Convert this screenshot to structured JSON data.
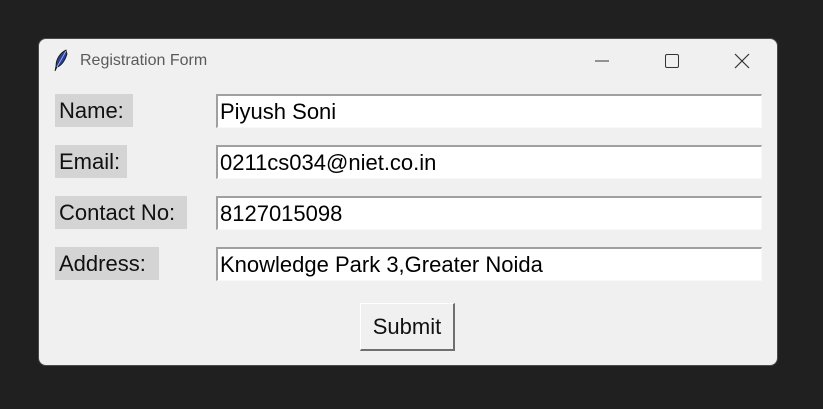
{
  "window": {
    "title": "Registration Form"
  },
  "form": {
    "name_label": "Name:",
    "name_value": "Piyush Soni",
    "email_label": "Email:",
    "email_value": "0211cs034@niet.co.in",
    "contact_label": "Contact No:",
    "contact_value": "8127015098",
    "address_label": "Address:",
    "address_value": "Knowledge Park 3,Greater Noida",
    "submit_label": "Submit"
  },
  "icons": {
    "app": "feather-icon",
    "minimize": "minimize-icon",
    "maximize": "maximize-icon",
    "close": "close-icon"
  },
  "colors": {
    "desktop_background": "#202020",
    "window_background": "#f0f0f0",
    "label_background": "#d4d4d4",
    "field_background": "#ffffff"
  }
}
